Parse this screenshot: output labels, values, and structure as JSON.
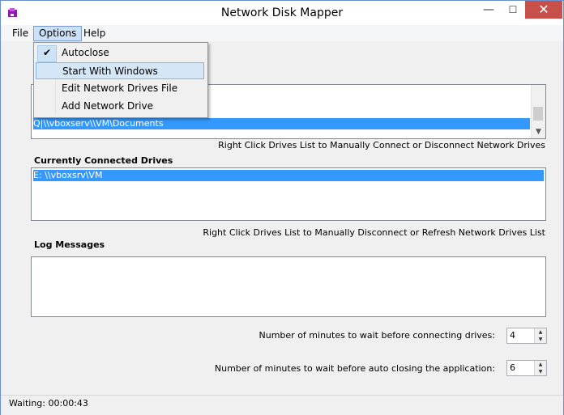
{
  "window": {
    "title": "Network Disk Mapper",
    "controls": {
      "minimize": "—",
      "maximize": "☐",
      "close": "✕"
    }
  },
  "menu": {
    "file": "File",
    "options": "Options",
    "help": "Help"
  },
  "options_menu": {
    "items": [
      {
        "label": "Autoclose",
        "checked": true
      },
      {
        "label": "Start With Windows",
        "checked": false
      },
      {
        "label": "Edit Network Drives File",
        "checked": false
      },
      {
        "label": "Add Network Drive",
        "checked": false
      }
    ]
  },
  "drives_file_list": {
    "rows": [
      "Q|\\\\vboxserv\\\\VM\\Documents"
    ],
    "hint": "Right Click Drives List to Manually Connect or Disconnect Network Drives"
  },
  "connected_drives": {
    "title": "Currently Connected Drives",
    "rows": [
      "E: \\\\vboxsrv\\VM"
    ],
    "hint": "Right Click Drives List to Manually Disconnect or Refresh Network Drives List"
  },
  "log": {
    "title": "Log Messages"
  },
  "settings": {
    "connect_wait_label": "Number of minutes to wait before connecting drives:",
    "connect_wait_value": "4",
    "autoclose_wait_label": "Number of minutes to wait before auto closing the application:",
    "autoclose_wait_value": "6"
  },
  "status": {
    "text": "Waiting: 00:00:43"
  }
}
